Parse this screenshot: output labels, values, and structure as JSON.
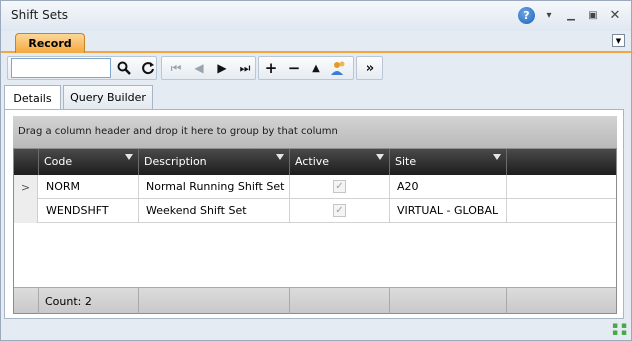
{
  "window": {
    "title": "Shift Sets",
    "help_label": "?",
    "record_tab": "Record"
  },
  "toolbar": {
    "search_value": "",
    "buttons": [
      "search-icon",
      "refresh-icon",
      "first-icon",
      "prev-icon",
      "next-icon",
      "last-icon",
      "add-icon",
      "remove-icon",
      "up-icon",
      "users-icon",
      "more-icon"
    ]
  },
  "panel_tabs": [
    "Details",
    "Query Builder"
  ],
  "grid": {
    "group_hint": "Drag a column header and drop it here to group by that column",
    "columns": [
      "Code",
      "Description",
      "Active",
      "Site"
    ],
    "rows": [
      {
        "code": "NORM",
        "description": "Normal Running Shift Set",
        "active": true,
        "site": "A20"
      },
      {
        "code": "WENDSHFT",
        "description": "Weekend Shift Set",
        "active": true,
        "site": "VIRTUAL - GLOBAL"
      }
    ],
    "count_label": "Count: 2"
  },
  "colors": {
    "accent": "#f5a83f",
    "header_bg": "#1d1d1d",
    "window_bg": "#e4ebf3"
  }
}
